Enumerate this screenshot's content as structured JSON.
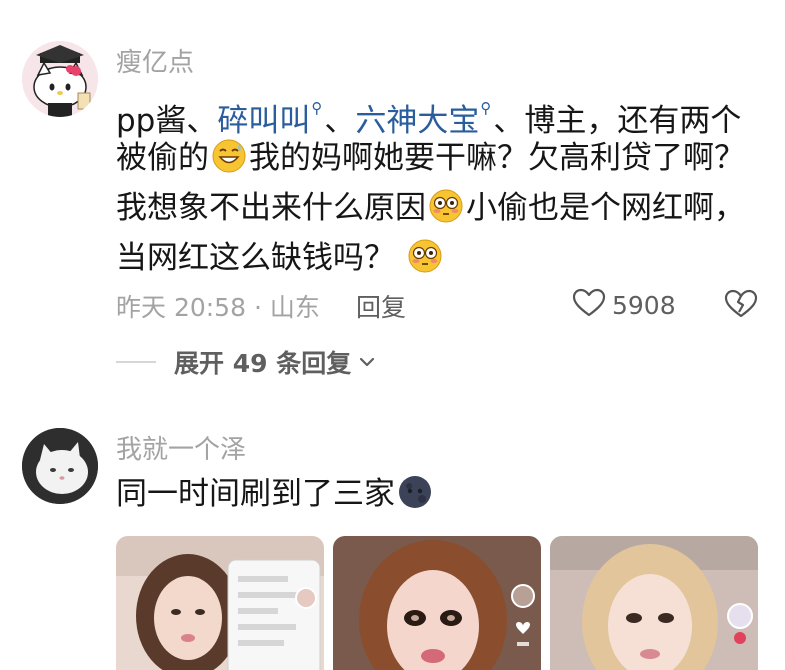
{
  "comments": [
    {
      "username": "瘦亿点",
      "text": {
        "line1_a": "pp酱、",
        "mention1": "碎叫叫",
        "sep1": "、",
        "mention2": "六神大宝",
        "line1_b": "、博主，还有两个",
        "line2_a": "被偷的",
        "line2_b": "我的妈啊她要干嘛？欠高利贷了啊？",
        "line3_a": "我想象不出来什么原因",
        "line3_b": "小偷也是个网红啊，",
        "line4_a": "当网红这么缺钱吗？"
      },
      "time_location": "昨天 20:58 · 山东",
      "reply_label": "回复",
      "like_count": "5908",
      "expand_replies_label": "展开 49 条回复"
    },
    {
      "username": "我就一个泽",
      "text": {
        "line1": "同一时间刷到了三家"
      }
    }
  ],
  "icons": {
    "avatar1": "hello-kitty-graduation-avatar",
    "avatar2": "white-cat-avatar",
    "mention_search": "search-icon",
    "emoji_laugh": "grinning-sweat-emoji",
    "emoji_flushed": "flushed-face-emoji",
    "emoji_moon": "new-moon-face-emoji",
    "like": "heart-outline-icon",
    "dislike": "broken-heart-icon",
    "expand": "chevron-down-icon"
  },
  "colors": {
    "username": "#a3a3a3",
    "body_text": "#161616",
    "mention": "#2a5d9c",
    "meta": "#a3a3a3",
    "action": "#5f5f5f"
  }
}
